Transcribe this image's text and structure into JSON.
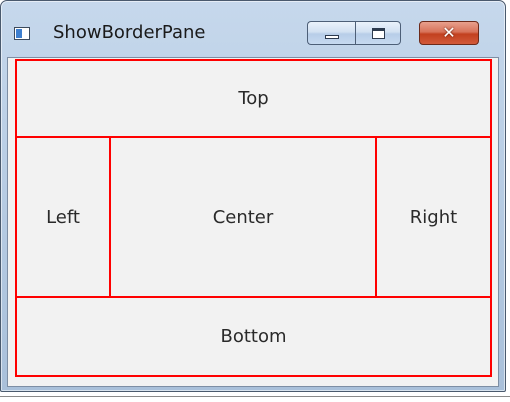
{
  "window": {
    "title": "ShowBorderPane",
    "controls": {
      "minimize": "minimize",
      "maximize": "maximize",
      "close": "✕"
    }
  },
  "border_pane": {
    "top": "Top",
    "left": "Left",
    "center": "Center",
    "right": "Right",
    "bottom": "Bottom"
  },
  "colors": {
    "pane_border": "#ff0000",
    "pane_background": "#f2f2f2",
    "titlebar": "#b8cde4",
    "close_button": "#c2401f"
  },
  "icons": [
    "app-window-icon",
    "minimize-icon",
    "maximize-icon",
    "close-icon"
  ]
}
